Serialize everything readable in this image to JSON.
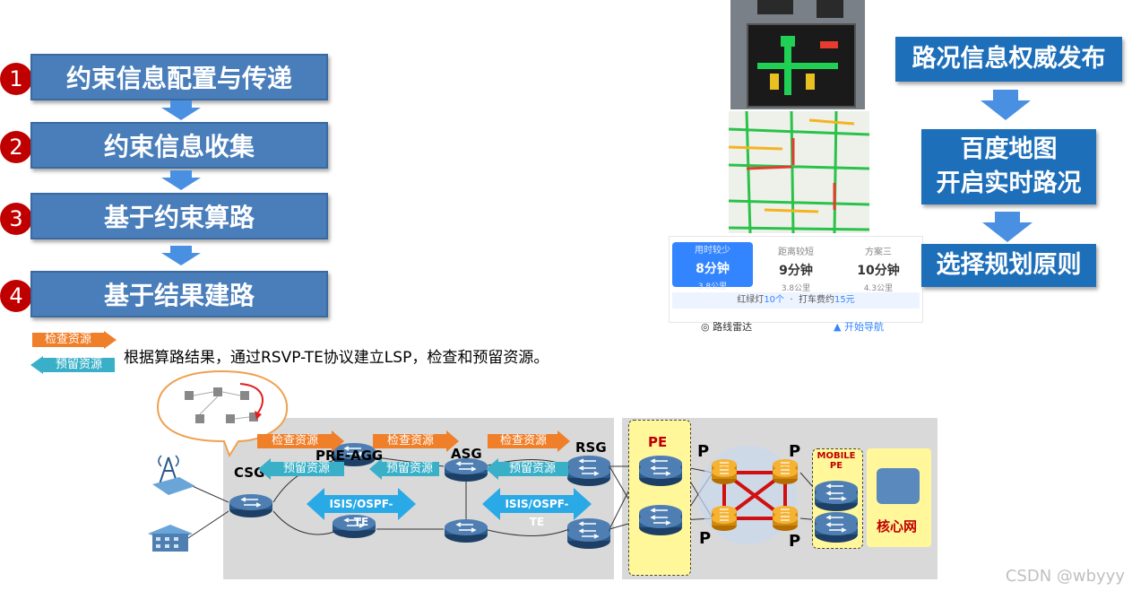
{
  "steps": [
    {
      "num": "1",
      "label": "约束信息配置与传递"
    },
    {
      "num": "2",
      "label": "约束信息收集"
    },
    {
      "num": "3",
      "label": "基于约束算路"
    },
    {
      "num": "4",
      "label": "基于结果建路"
    }
  ],
  "legend": {
    "check_label": "检查资源",
    "reserve_label": "预留资源",
    "description": "根据算路结果，通过RSVP-TE协议建立LSP，检查和预留资源。"
  },
  "flow": {
    "box1": "路况信息权威发布",
    "box2_line1": "百度地图",
    "box2_line2": "开启实时路况",
    "box3": "选择规划原则"
  },
  "route_card": {
    "options": [
      {
        "tag": "用时较少",
        "time": "8分钟",
        "dist": "3.8公里"
      },
      {
        "tag": "距离较短",
        "time": "9分钟",
        "dist": "3.8公里"
      },
      {
        "tag": "方案三",
        "time": "10分钟",
        "dist": "4.3公里"
      }
    ],
    "info_prefix": "红绿灯",
    "info_lights": "10个",
    "info_mid": "打车费约",
    "info_fare": "15元",
    "radar": "路线雷达",
    "navigate": "开始导航"
  },
  "network": {
    "csg": "CSG",
    "pre_agg": "PRE-AGG",
    "asg": "ASG",
    "rsg": "RSG",
    "pe": "PE",
    "p": "P",
    "mobile_pe_line1": "MOBILE",
    "mobile_pe_line2": "PE",
    "core": "核心网",
    "igp": "ISIS/OSPF-TE",
    "check": "检查资源",
    "reserve": "预留资源"
  },
  "watermark": "CSDN @wbyyy",
  "colors": {
    "step_box": "#4a7ebb",
    "step_circle": "#c00000",
    "flow_box": "#1e6fba",
    "arrow": "#4a90e2",
    "check_arrow": "#f07f2a",
    "reserve_arrow": "#3ab0c8",
    "igp_arrow": "#29a9e6",
    "router_orange": "#f0a020",
    "router_blue": "#2a5a8a",
    "pe_zone": "#fff79a"
  }
}
